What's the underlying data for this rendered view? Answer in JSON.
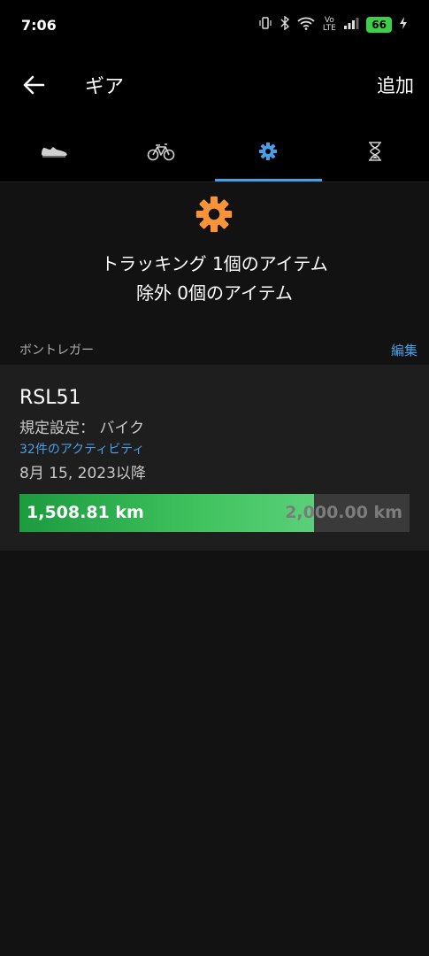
{
  "status_bar": {
    "time": "7:06",
    "battery": "66",
    "network": "Vo LTE"
  },
  "app_bar": {
    "title": "ギア",
    "add_label": "追加"
  },
  "tabs": [
    {
      "icon": "shoe-icon",
      "active": false
    },
    {
      "icon": "bike-icon",
      "active": false
    },
    {
      "icon": "gear-icon",
      "active": true
    },
    {
      "icon": "hourglass-icon",
      "active": false
    }
  ],
  "summary": {
    "tracking": "トラッキング 1個のアイテム",
    "excluded": "除外 0個のアイテム"
  },
  "section": {
    "label": "ボントレガー",
    "edit_label": "編集"
  },
  "gear_item": {
    "name": "RSL51",
    "default_setting": "規定設定： バイク",
    "activities": "32件のアクティビティ",
    "since": "8月 15, 2023以降",
    "current_distance": "1,508.81 km",
    "goal_distance": "2,000.00 km",
    "progress_fraction": 0.7544
  },
  "colors": {
    "accent": "#4a9ee8",
    "gear_icon": "#f7943a",
    "progress_green": "#3fc25e"
  }
}
